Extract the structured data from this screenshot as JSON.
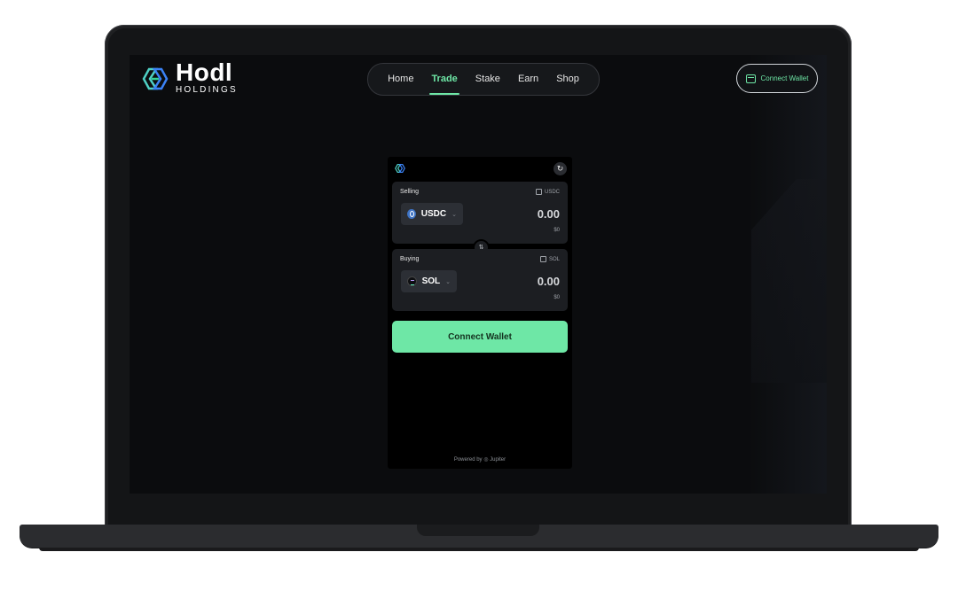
{
  "header": {
    "logo_title": "Hodl",
    "logo_subtitle": "HOLDINGS",
    "nav": [
      {
        "label": "Home",
        "active": false
      },
      {
        "label": "Trade",
        "active": true
      },
      {
        "label": "Stake",
        "active": false
      },
      {
        "label": "Earn",
        "active": false
      },
      {
        "label": "Shop",
        "active": false
      }
    ],
    "connect_label": "Connect Wallet"
  },
  "widget": {
    "refresh_icon": "refresh-icon",
    "sell": {
      "label": "Selling",
      "balance_token": "USDC",
      "token": "USDC",
      "amount": "0.00",
      "usd_value": "$0"
    },
    "buy": {
      "label": "Buying",
      "balance_token": "SOL",
      "token": "SOL",
      "amount": "0.00",
      "usd_value": "$0"
    },
    "connect_label": "Connect Wallet",
    "powered_by": "Powered by",
    "powered_brand": "Jupiter"
  },
  "colors": {
    "accent": "#6ee7a6",
    "screen_bg": "#0b0c0e",
    "panel_bg": "#1c1e22"
  }
}
